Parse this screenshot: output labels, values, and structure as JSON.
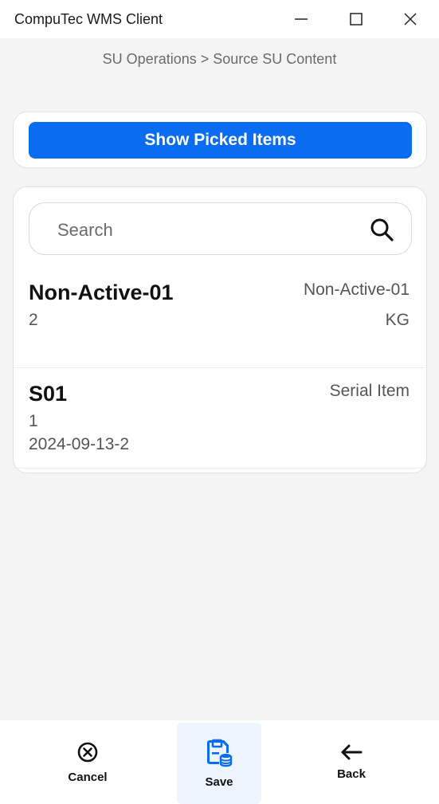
{
  "window": {
    "title": "CompuTec WMS Client",
    "controls": [
      "minimize-icon",
      "maximize-icon",
      "close-icon"
    ]
  },
  "breadcrumb": "SU Operations > Source SU Content",
  "actions": {
    "show_picked_label": "Show Picked Items"
  },
  "search": {
    "placeholder": "Search",
    "icon": "search-icon"
  },
  "items": [
    {
      "name": "Non-Active-01",
      "right_top": "Non-Active-01",
      "quantity": "2",
      "uom": "KG"
    },
    {
      "name": "S01",
      "right_top": "Serial Item",
      "quantity": "1",
      "serial": "2024-09-13-2"
    }
  ],
  "bottom_nav": {
    "cancel_label": "Cancel",
    "save_label": "Save",
    "back_label": "Back"
  },
  "colors": {
    "primary": "#0a6cf0",
    "background": "#f3f4f3",
    "save_highlight": "#eef5fe"
  }
}
